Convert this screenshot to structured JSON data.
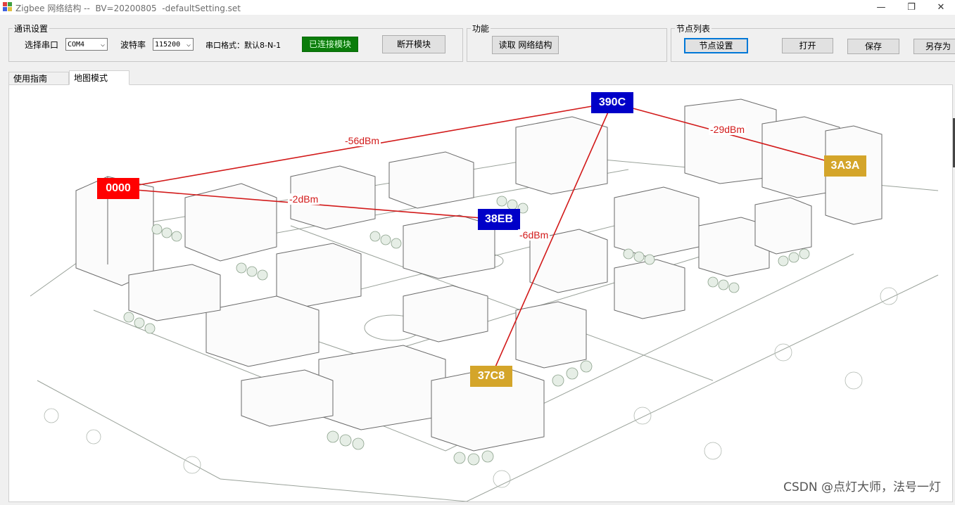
{
  "window": {
    "title": "Zigbee 网络结构 --  BV=20200805  -defaultSetting.set",
    "minimize": "—",
    "restore": "❐",
    "close": "✕"
  },
  "comm": {
    "legend": "通讯设置",
    "port_label": "选择串口",
    "port_value": "COM4",
    "baud_label": "波特率",
    "baud_value": "115200",
    "format_label": "串口格式：默认8-N-1",
    "connected_btn": "已连接模块",
    "disconnect_btn": "断开模块"
  },
  "func": {
    "legend": "功能",
    "read_btn": "读取 网络结构"
  },
  "nodes_panel": {
    "legend": "节点列表",
    "settings_btn": "节点设置",
    "open_btn": "打开",
    "save_btn": "保存",
    "saveas_btn": "另存为"
  },
  "tabs": [
    {
      "label": "使用指南"
    },
    {
      "label": "地图模式"
    }
  ],
  "map": {
    "nodes": [
      {
        "id": "0000",
        "color": "#ff0000"
      },
      {
        "id": "390C",
        "color": "#0000c8"
      },
      {
        "id": "38EB",
        "color": "#0000c8"
      },
      {
        "id": "3A3A",
        "color": "#d4a52a"
      },
      {
        "id": "37C8",
        "color": "#d4a52a"
      }
    ],
    "links": [
      {
        "from": "0000",
        "to": "390C",
        "rssi": "-56dBm"
      },
      {
        "from": "0000",
        "to": "38EB",
        "rssi": "-2dBm"
      },
      {
        "from": "390C",
        "to": "3A3A",
        "rssi": "-29dBm"
      },
      {
        "from": "390C",
        "to": "37C8",
        "rssi": "-6dBm"
      }
    ],
    "link_color": "#d21a1a"
  },
  "watermark": "CSDN @点灯大师，法号一灯"
}
